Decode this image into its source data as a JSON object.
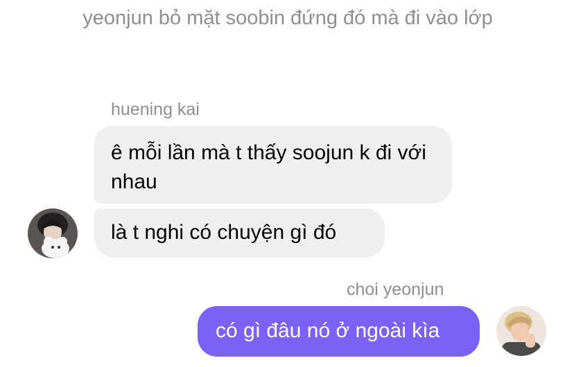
{
  "narration": {
    "text": "yeonjun bỏ mặt soobin đứng đó mà đi vào lớp"
  },
  "thread": {
    "incoming": {
      "sender_name": "huening kai",
      "messages": [
        "ê mỗi lần mà t thấy soojun k đi với nhau",
        "là t nghi có chuyện gì đó"
      ]
    },
    "outgoing": {
      "sender_name": "choi yeonjun",
      "messages": [
        "có gì đâu nó ở ngoài kìa"
      ]
    }
  },
  "colors": {
    "incoming_bubble": "#efefef",
    "outgoing_bubble": "#7b62f5",
    "meta_text": "#8e8e93"
  },
  "icons": {
    "incoming_avatar": "avatar-huening-kai",
    "outgoing_avatar": "avatar-choi-yeonjun"
  }
}
